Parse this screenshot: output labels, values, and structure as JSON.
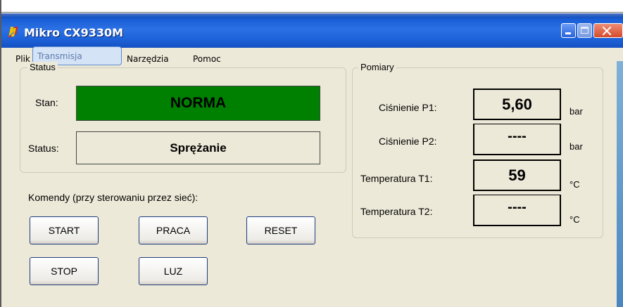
{
  "window": {
    "title": "Mikro CX9330M"
  },
  "menu": [
    {
      "label": "Plik"
    },
    {
      "label": "Transmisja"
    },
    {
      "label": "Narzędzia"
    },
    {
      "label": "Pomoc"
    }
  ],
  "status_group": {
    "legend": "Status",
    "stan_label": "Stan:",
    "stan_value": "NORMA",
    "stan_color": "#008000",
    "status_label": "Status:",
    "status_value": "Sprężanie"
  },
  "commands": {
    "label": "Komendy (przy sterowaniu przez sieć):",
    "start": "START",
    "praca": "PRACA",
    "reset": "RESET",
    "stop": "STOP",
    "luz": "LUZ"
  },
  "measurements": {
    "legend": "Pomiary",
    "rows": [
      {
        "label": "Ciśnienie P1:",
        "value": "5,60",
        "unit": "bar"
      },
      {
        "label": "Ciśnienie P2:",
        "value": "----",
        "unit": "bar"
      },
      {
        "label": "Temperatura T1:",
        "value": "59",
        "unit": "°C"
      },
      {
        "label": "Temperatura T2:",
        "value": "----",
        "unit": "°C"
      }
    ]
  },
  "icons": {
    "app": "app-logo-icon",
    "minimize": "minimize-icon",
    "maximize": "maximize-icon",
    "close": "close-icon"
  }
}
